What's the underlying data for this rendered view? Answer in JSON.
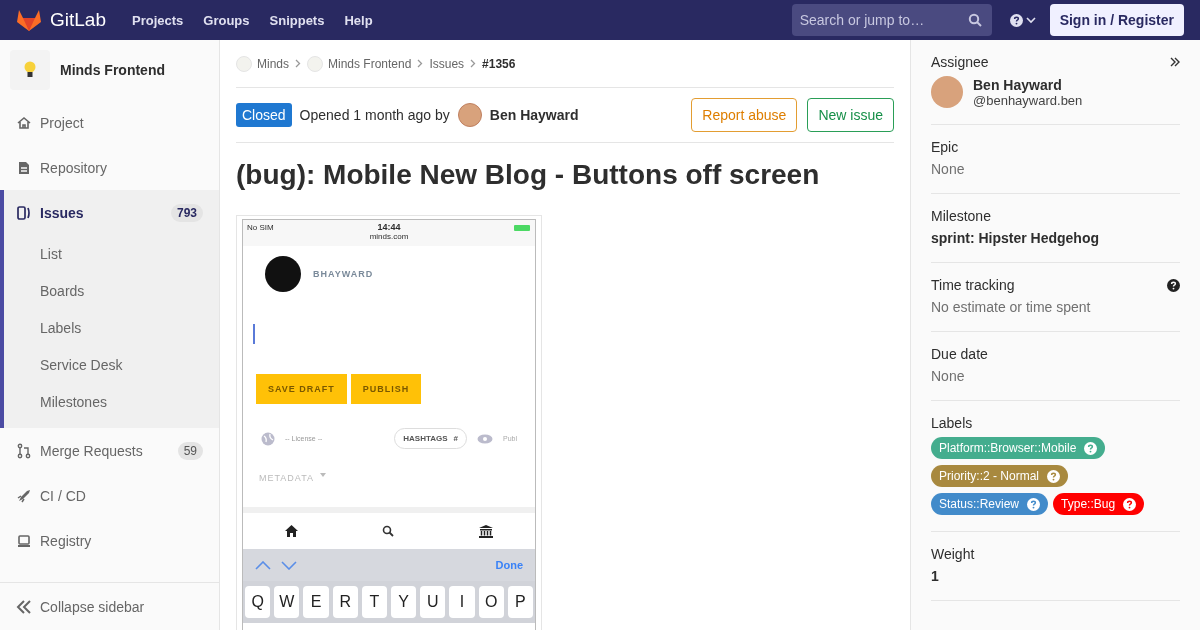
{
  "header": {
    "logo": "GitLab",
    "nav": [
      "Projects",
      "Groups",
      "Snippets",
      "Help"
    ],
    "search": {
      "placeholder": "Search or jump to…"
    },
    "sign_in": "Sign in / Register"
  },
  "sidebar": {
    "project": "Minds Frontend",
    "items": [
      {
        "label": "Project",
        "selected": false
      },
      {
        "label": "Repository",
        "selected": false
      },
      {
        "label": "Issues",
        "count": "793",
        "selected": true,
        "children": [
          {
            "label": "List",
            "selected": false
          },
          {
            "label": "Boards",
            "selected": false
          },
          {
            "label": "Labels",
            "selected": false
          },
          {
            "label": "Service Desk",
            "selected": false
          },
          {
            "label": "Milestones",
            "selected": false
          }
        ]
      },
      {
        "label": "Merge Requests",
        "count": "59",
        "selected": false
      },
      {
        "label": "CI / CD",
        "selected": false
      },
      {
        "label": "Registry",
        "selected": false
      }
    ],
    "collapse": "Collapse sidebar"
  },
  "breadcrumbs": [
    {
      "label": "Minds",
      "kind": "group"
    },
    {
      "label": "Minds Frontend",
      "kind": "group"
    },
    {
      "label": "Issues",
      "kind": "link"
    },
    {
      "label": "#1356",
      "kind": "current"
    }
  ],
  "issue": {
    "status": "Closed",
    "opened": "Opened 1 month ago by",
    "author": "Ben Hayward",
    "title": "(bug): Mobile New Blog - Buttons off screen",
    "actions": [
      {
        "label": "Report abuse",
        "kind": "warning"
      },
      {
        "label": "New issue",
        "kind": "success"
      }
    ]
  },
  "attachment": {
    "carrier": "No SIM",
    "time": "14:44",
    "url": "minds.com",
    "username": "BHAYWARD",
    "buttons": [
      "SAVE DRAFT",
      "PUBLISH"
    ],
    "license": "-- License --",
    "hashtags": "HASHTAGS",
    "hashtag_symbol": "#",
    "visibility": "Publ",
    "metadata": "METADATA",
    "done": "Done",
    "keys": [
      "Q",
      "W",
      "E",
      "R",
      "T",
      "Y",
      "U",
      "I",
      "O",
      "P"
    ]
  },
  "right_sidebar": {
    "assignee": {
      "label": "Assignee",
      "name": "Ben Hayward",
      "username": "@benhayward.ben"
    },
    "sections": [
      {
        "label": "Epic",
        "value": "None",
        "emphasis": false,
        "help": false
      },
      {
        "label": "Milestone",
        "value": "sprint: Hipster Hedgehog",
        "emphasis": true,
        "help": false
      },
      {
        "label": "Time tracking",
        "value": "No estimate or time spent",
        "emphasis": false,
        "help": true
      },
      {
        "label": "Due date",
        "value": "None",
        "emphasis": false,
        "help": false
      }
    ],
    "labels": {
      "label": "Labels",
      "items": [
        {
          "text": "Platform::Browser::Mobile",
          "color": "#44ad8e"
        },
        {
          "text": "Priority::2 - Normal",
          "color": "#a8893f"
        },
        {
          "text": "Status::Review",
          "color": "#428bca"
        },
        {
          "text": "Type::Bug",
          "color": "#ff0000"
        }
      ]
    },
    "weight": {
      "label": "Weight",
      "value": "1"
    }
  }
}
